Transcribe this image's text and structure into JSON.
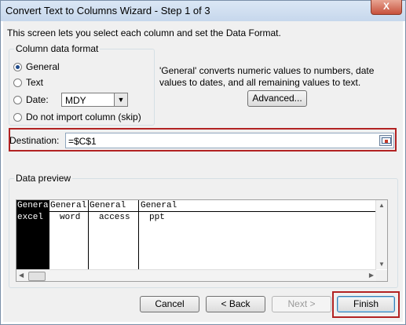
{
  "window": {
    "title": "Convert Text to Columns Wizard - Step 1 of 3",
    "close_label": "X"
  },
  "intro": "This screen lets you select each column and set the Data Format.",
  "format_group": {
    "label": "Column data format",
    "options": [
      {
        "label": "General",
        "checked": true
      },
      {
        "label": "Text",
        "checked": false
      },
      {
        "label": "Date:",
        "checked": false
      },
      {
        "label": "Do not import column (skip)",
        "checked": false
      }
    ],
    "date_value": "MDY"
  },
  "description": "'General' converts numeric values to numbers, date values to dates, and all remaining values to text.",
  "advanced_label": "Advanced...",
  "destination": {
    "label": "Destination:",
    "value": "=$C$1"
  },
  "preview": {
    "label": "Data preview",
    "columns": [
      {
        "header": "General",
        "value": "excel"
      },
      {
        "header": "General",
        "value": "word"
      },
      {
        "header": "General",
        "value": "access"
      },
      {
        "header": "General",
        "value": "ppt"
      }
    ]
  },
  "buttons": {
    "cancel": "Cancel",
    "back": "< Back",
    "next": "Next >",
    "finish": "Finish"
  }
}
